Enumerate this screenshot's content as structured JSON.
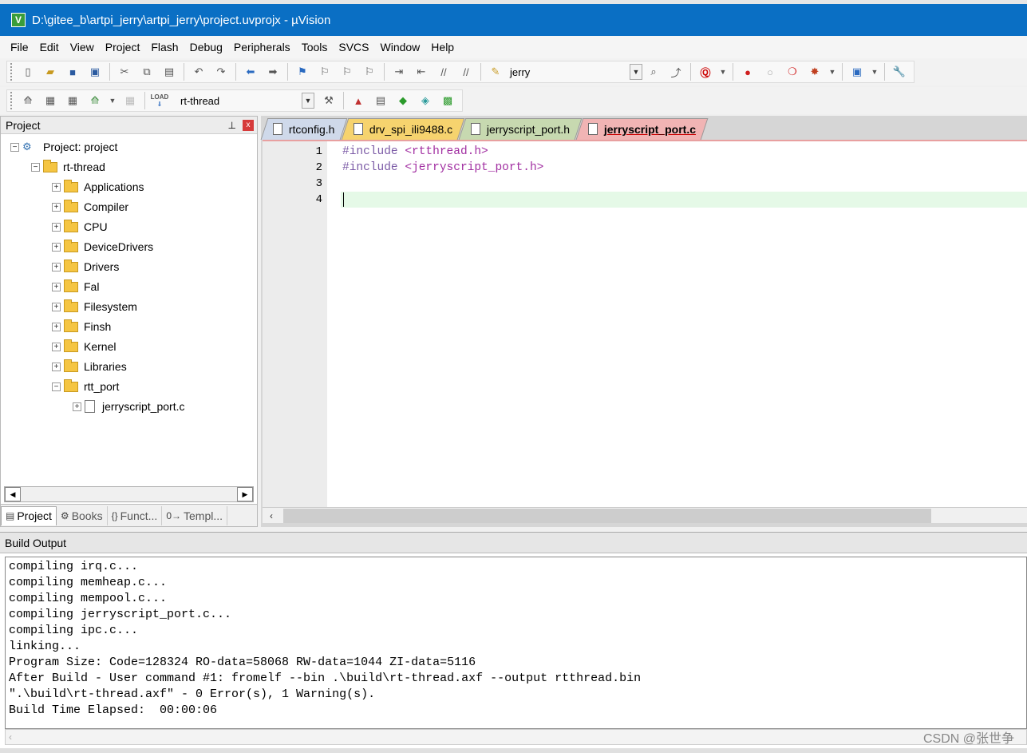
{
  "window": {
    "title": "D:\\gitee_b\\artpi_jerry\\artpi_jerry\\project.uvprojx - µVision",
    "app_icon_letter": "V"
  },
  "menu": [
    "File",
    "Edit",
    "View",
    "Project",
    "Flash",
    "Debug",
    "Peripherals",
    "Tools",
    "SVCS",
    "Window",
    "Help"
  ],
  "toolbar": {
    "find_text": "jerry",
    "target_select": "rt-thread",
    "load_label": "LOAD"
  },
  "project_panel": {
    "title": "Project",
    "pin": "■",
    "close": "x",
    "tree": [
      {
        "label": "Project: project",
        "level": 0,
        "kind": "project",
        "exp": "−"
      },
      {
        "label": "rt-thread",
        "level": 1,
        "kind": "folder-open",
        "exp": "−"
      },
      {
        "label": "Applications",
        "level": 2,
        "kind": "folder",
        "exp": "+"
      },
      {
        "label": "Compiler",
        "level": 2,
        "kind": "folder",
        "exp": "+"
      },
      {
        "label": "CPU",
        "level": 2,
        "kind": "folder",
        "exp": "+"
      },
      {
        "label": "DeviceDrivers",
        "level": 2,
        "kind": "folder",
        "exp": "+"
      },
      {
        "label": "Drivers",
        "level": 2,
        "kind": "folder",
        "exp": "+"
      },
      {
        "label": "Fal",
        "level": 2,
        "kind": "folder",
        "exp": "+"
      },
      {
        "label": "Filesystem",
        "level": 2,
        "kind": "folder",
        "exp": "+"
      },
      {
        "label": "Finsh",
        "level": 2,
        "kind": "folder",
        "exp": "+"
      },
      {
        "label": "Kernel",
        "level": 2,
        "kind": "folder",
        "exp": "+"
      },
      {
        "label": "Libraries",
        "level": 2,
        "kind": "folder",
        "exp": "+"
      },
      {
        "label": "rtt_port",
        "level": 2,
        "kind": "folder-open",
        "exp": "−"
      },
      {
        "label": "jerryscript_port.c",
        "level": 3,
        "kind": "file",
        "exp": "+"
      }
    ],
    "tabs": [
      {
        "label": "Project",
        "icon": "project-icon",
        "glyph": "▤",
        "active": true
      },
      {
        "label": "Books",
        "icon": "books-icon",
        "glyph": "⚙",
        "active": false
      },
      {
        "label": "Funct...",
        "icon": "functions-icon",
        "glyph": "{}",
        "active": false
      },
      {
        "label": "Templ...",
        "icon": "templates-icon",
        "glyph": "0→",
        "active": false
      }
    ]
  },
  "editor": {
    "tabs": [
      {
        "label": "rtconfig.h",
        "active": false
      },
      {
        "label": "drv_spi_ili9488.c",
        "active": false
      },
      {
        "label": "jerryscript_port.h",
        "active": false
      },
      {
        "label": "jerryscript_port.c",
        "active": true
      }
    ],
    "lines": [
      {
        "num": "1",
        "kw": "#include",
        "str": "<rtthread.h>"
      },
      {
        "num": "2",
        "kw": "#include",
        "str": "<jerryscript_port.h>"
      },
      {
        "num": "3",
        "kw": "",
        "str": ""
      },
      {
        "num": "4",
        "kw": "",
        "str": ""
      }
    ],
    "current_line": 4
  },
  "build_output": {
    "title": "Build Output",
    "lines": [
      "compiling irq.c...",
      "compiling memheap.c...",
      "compiling mempool.c...",
      "compiling jerryscript_port.c...",
      "compiling ipc.c...",
      "linking...",
      "Program Size: Code=128324 RO-data=58068 RW-data=1044 ZI-data=5116",
      "After Build - User command #1: fromelf --bin .\\build\\rt-thread.axf --output rtthread.bin",
      "\".\\build\\rt-thread.axf\" - 0 Error(s), 1 Warning(s).",
      "Build Time Elapsed:  00:00:06"
    ]
  },
  "watermark": "CSDN @张世争"
}
